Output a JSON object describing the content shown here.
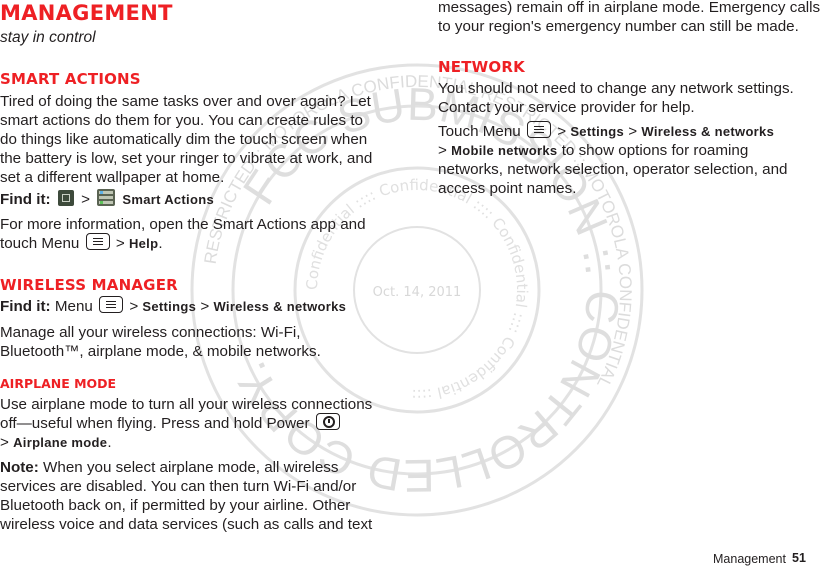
{
  "page": {
    "title": "MANAGEMENT",
    "subtitle": "stay in control",
    "accent_color": "#ee2024",
    "footer": {
      "section": "Management",
      "page_number": "51"
    }
  },
  "smart_actions": {
    "heading": "SMART ACTIONS",
    "body_lines": [
      "Tired of doing the same tasks over and over again? Let",
      "smart actions do them for you. You can create rules to",
      "do things like automatically dim the touch screen when",
      "the battery is low, set your ringer to vibrate at work, and",
      "set a different wallpaper at home."
    ],
    "find_it_label": "Find it:",
    "find_it_sep": ">",
    "find_it_target": "Smart Actions",
    "more_line1": "For more information, open the Smart Actions app and",
    "more_line2_pre": "touch Menu",
    "more_line2_sep": ">",
    "more_line2_target": "Help",
    "more_line2_end": ".",
    "icons": [
      "apps-launcher-icon",
      "smart-actions-app-icon",
      "menu-key-icon"
    ]
  },
  "wireless_manager": {
    "heading": "WIRELESS MANAGER",
    "find_it_label": "Find it:",
    "find_it_pre": "Menu",
    "sep": ">",
    "path1": "Settings",
    "path2": "Wireless & networks",
    "body_line1": "Manage all your wireless connections: Wi-Fi,",
    "body_line2": "Bluetooth™, airplane mode, & mobile networks."
  },
  "airplane_mode": {
    "heading": "AIRPLANE MODE",
    "line1": "Use airplane mode to turn all your wireless connections",
    "line2": "off—useful when flying. Press and hold Power",
    "line3_sep": ">",
    "line3_target": "Airplane mode",
    "line3_end": ".",
    "note_label": "Note:",
    "note_line1": "When you select airplane mode, all wireless",
    "note_line2": "services are disabled. You can then turn Wi-Fi and/or",
    "note_line3": "Bluetooth back on, if permitted by your airline. Other",
    "note_line4": "wireless voice and data services (such as calls and text",
    "note_line5": "messages) remain off in airplane mode. Emergency calls",
    "note_line6": "to your region's emergency number can still be made."
  },
  "network": {
    "heading": "NETWORK",
    "line1": "You should not need to change any network settings.",
    "line2": "Contact your service provider for help.",
    "touch_pre": "Touch Menu",
    "sep": ">",
    "path1": "Settings",
    "path2": "Wireless & networks",
    "path3": "Mobile networks",
    "line4_rest": "to show options for roaming",
    "line5": "networks, network selection, operator selection, and",
    "line6": "access point names."
  },
  "watermark": {
    "outer_text": "RESTRICTED :: MOTOROLA CONFIDENTIAL RESTRICTED :: MOTOROLA CONFIDENTIAL",
    "middle_text": "FCC SUBMISSION :: CONTROLLED COPY.",
    "inner_text": "Confidential :::: Confidential :::: Confidential :::: Confidential ::::",
    "date": "Oct. 14, 2011",
    "color": "#d9d9d9"
  }
}
